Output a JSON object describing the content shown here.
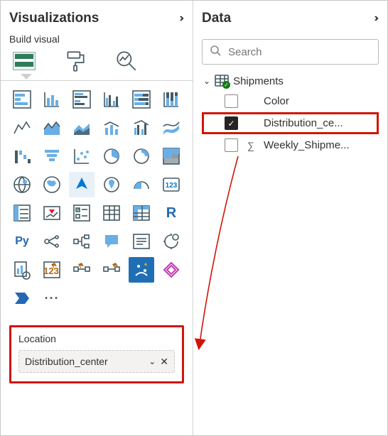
{
  "viz": {
    "title": "Visualizations",
    "subheader": "Build visual",
    "tabs": {
      "fields_name": "build-visual-tab",
      "format_name": "format-visual-tab",
      "analytics_name": "analytics-tab"
    },
    "gallery": [
      "stacked-bar",
      "stacked-column",
      "clustered-bar",
      "clustered-column",
      "100-stacked-bar",
      "100-stacked-column",
      "line",
      "area",
      "stacked-area",
      "line-stacked-column",
      "line-clustered-column",
      "ribbon",
      "waterfall",
      "funnel",
      "scatter",
      "pie",
      "donut",
      "treemap",
      "map",
      "filled-map",
      "azure-map",
      "arcgis-map",
      "gauge",
      "card",
      "multi-row-card",
      "kpi",
      "slicer",
      "table",
      "matrix",
      "r-visual",
      "python-visual",
      "key-influencers",
      "decomposition-tree",
      "qna",
      "smart-narrative",
      "paginated",
      "metrics",
      "power-apps",
      "power-automate",
      "ai-insights",
      "more-visuals",
      "get-more-visuals",
      "power-automate-2",
      "ellipsis"
    ],
    "well": {
      "label": "Location",
      "field": "Distribution_center"
    }
  },
  "data": {
    "title": "Data",
    "search_placeholder": "Search",
    "table": {
      "name": "Shipments",
      "expanded": true,
      "has_selection": true,
      "fields": [
        {
          "name": "Color",
          "checked": false,
          "agg": false
        },
        {
          "name": "Distribution_ce...",
          "checked": true,
          "agg": false,
          "highlight": true
        },
        {
          "name": "Weekly_Shipme...",
          "checked": false,
          "agg": true
        }
      ]
    }
  }
}
